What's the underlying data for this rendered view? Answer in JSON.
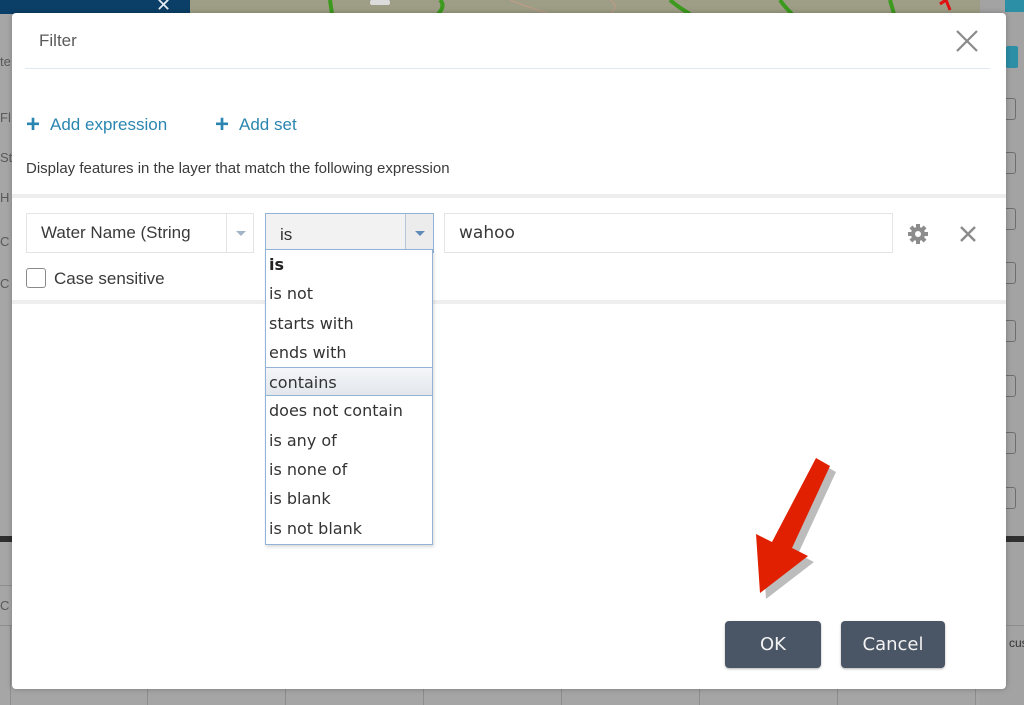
{
  "background": {
    "left_letters": [
      "te",
      "Fl",
      "St",
      "H",
      "C",
      "C",
      "C"
    ],
    "bottom_right_text": "cus"
  },
  "dialog": {
    "title": "Filter",
    "close_icon": "close-icon",
    "add_expression_label": "Add expression",
    "add_set_label": "Add set",
    "description": "Display features in the layer that match the following expression",
    "expression": {
      "field": "Water Name (String",
      "operator": "is",
      "value": "wahoo",
      "case_sensitive_label": "Case sensitive",
      "case_sensitive_checked": false
    },
    "operator_options": [
      {
        "label": "is",
        "selected": true
      },
      {
        "label": "is not"
      },
      {
        "label": "starts with"
      },
      {
        "label": "ends with"
      },
      {
        "label": "contains",
        "hover": true
      },
      {
        "label": "does not contain"
      },
      {
        "label": "is any of"
      },
      {
        "label": "is none of"
      },
      {
        "label": "is blank"
      },
      {
        "label": "is not blank"
      }
    ],
    "ok_label": "OK",
    "cancel_label": "Cancel"
  },
  "annotation": {
    "arrow_color": "#e02000",
    "points_to": "OK"
  },
  "colors": {
    "accent_link": "#2a86b0",
    "button_bg": "#4a5666",
    "topbar": "#0b3f67"
  }
}
